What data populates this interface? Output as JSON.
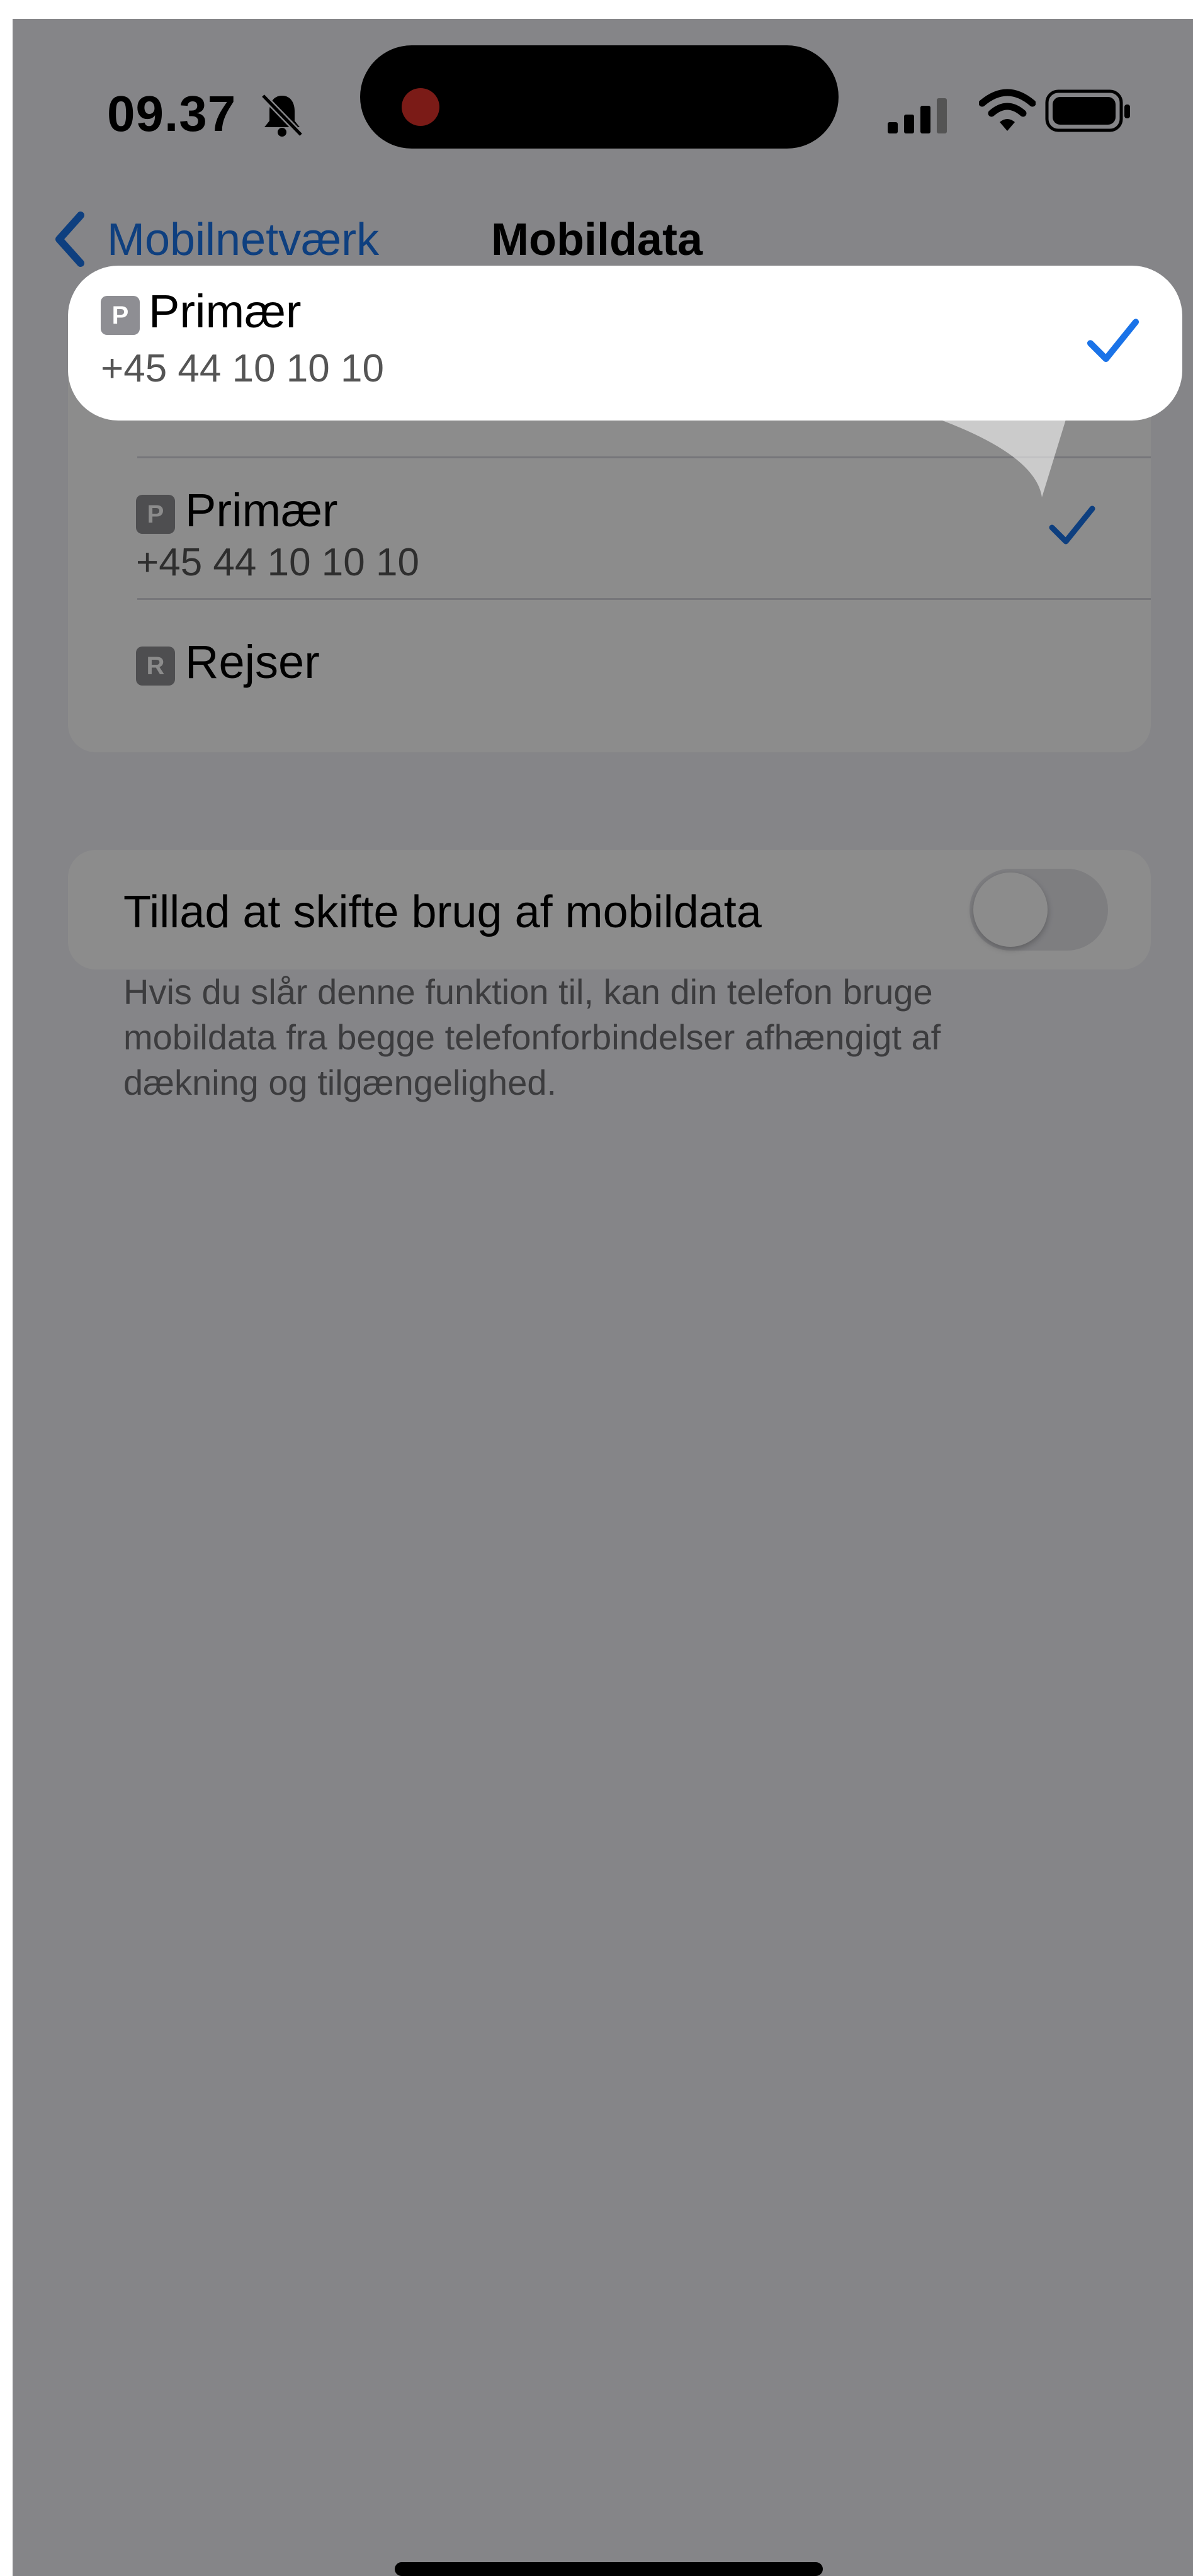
{
  "status_bar": {
    "time": "09.37",
    "icons": [
      "bell-slash-icon",
      "cellular-icon",
      "wifi-icon",
      "battery-icon"
    ]
  },
  "nav": {
    "back_label": "Mobilnetværk",
    "title": "Mobildata"
  },
  "lines": [
    {
      "badge": "P",
      "name": "Primær",
      "number": "+45 44 10 10 10",
      "selected": true
    },
    {
      "badge": "R",
      "name": "Rejser",
      "number": "",
      "selected": false
    }
  ],
  "callout": {
    "badge": "P",
    "name": "Primær",
    "number": "+45 44 10 10 10",
    "selected": true
  },
  "data_switching": {
    "label": "Tillad at skifte brug af mobildata",
    "enabled": false,
    "footnote": "Hvis du slår denne funktion til, kan din telefon bruge mobildata fra begge telefonforbindelser afhængigt af dækning og tilgængelighed."
  },
  "colors": {
    "accent": "#1a73e8",
    "background": "#f2f2f7",
    "overlay": "rgba(0,0,0,0.45)"
  }
}
